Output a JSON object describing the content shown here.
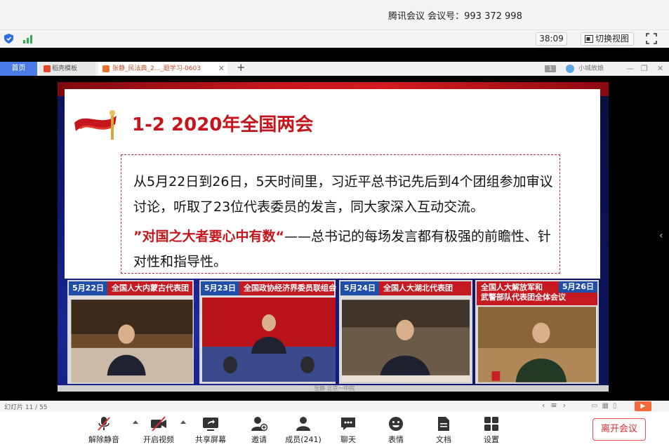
{
  "meeting": {
    "title": "腾讯会议  会议号：993 372 998",
    "timer": "38:09",
    "switch_view_label": "切换视图"
  },
  "wps": {
    "home_tab": "首页",
    "tabs": [
      {
        "label": "稻壳模板"
      },
      {
        "label": "张静_民法典_2..._题学习-0603"
      }
    ],
    "page_indicator": "1",
    "user_name": "小城故娘",
    "slide_counter": "幻灯片 11 / 55"
  },
  "slide": {
    "title": "1-2 2020年全国两会",
    "paragraph1": "从5月22日到26日，5天时间里，习近平总书记先后到4个团组参加审议讨论，听取了23位代表委员的发言，同大家深入互动交流。",
    "paragraph2_emphasis": "”对国之大者要心中有数“",
    "paragraph2_rest": "——总书记的每场发言都有极强的前瞻性、针对性和指导性。",
    "panels": [
      {
        "date": "5月22日",
        "caption": "全国人大内蒙古代表团"
      },
      {
        "date": "5月23日",
        "caption": "全国政协经济界委员联组会"
      },
      {
        "date": "5月24日",
        "caption": "全国人大湖北代表团"
      },
      {
        "date": "5月26日",
        "caption_line1": "全国人大解放军和",
        "caption_line2": "武警部队代表团全体会议"
      }
    ],
    "footer_caption": "张静  北京一中院"
  },
  "toolbar": {
    "buttons": [
      {
        "label": "解除静音",
        "icon": "mic-muted-icon"
      },
      {
        "label": "开启视频",
        "icon": "camera-off-icon"
      },
      {
        "label": "共享屏幕",
        "icon": "share-screen-icon"
      },
      {
        "label": "邀请",
        "icon": "invite-icon"
      },
      {
        "label": "成员(241)",
        "icon": "members-icon"
      },
      {
        "label": "聊天",
        "icon": "chat-icon"
      },
      {
        "label": "表情",
        "icon": "emoji-icon"
      },
      {
        "label": "文档",
        "icon": "document-icon"
      },
      {
        "label": "设置",
        "icon": "settings-icon"
      }
    ],
    "leave_label": "离开会议"
  },
  "colors": {
    "accent_red": "#c4161c",
    "home_tab_blue": "#4a7be8",
    "leave_red": "#d83030"
  }
}
